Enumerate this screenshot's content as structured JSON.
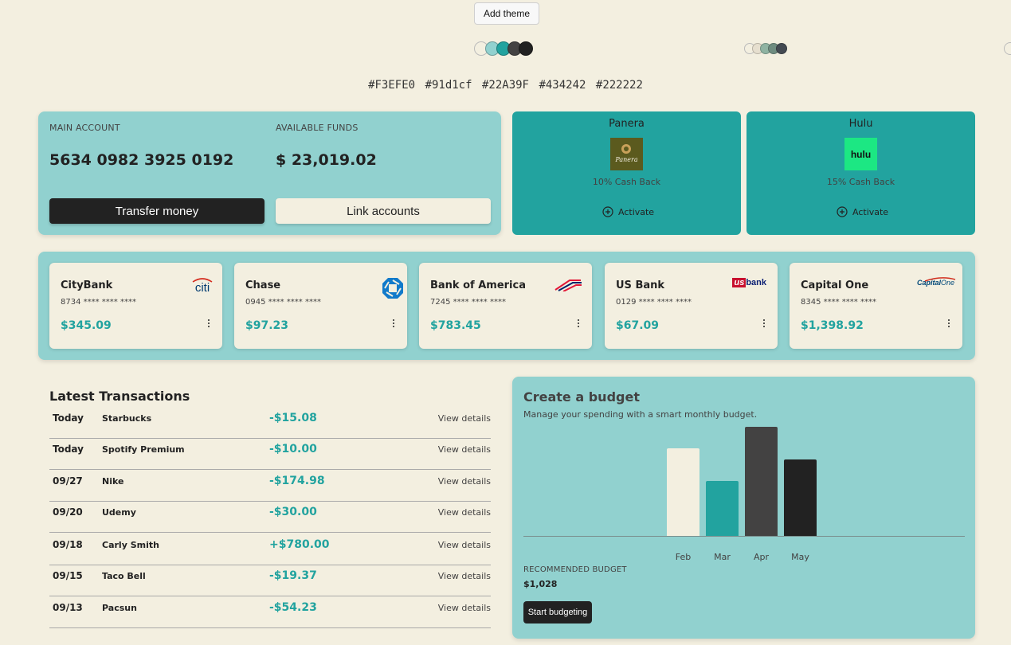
{
  "toolbar": {
    "add_theme_label": "Add theme"
  },
  "palette": {
    "colors": [
      "#F3EFE0",
      "#91d1cf",
      "#22A39F",
      "#434242",
      "#222222"
    ],
    "labels": [
      "#F3EFE0",
      "#91d1cf",
      "#22A39F",
      "#434242",
      "#222222"
    ],
    "alt_palette_colors": [
      "#F3EFE0",
      "#e6dfcf",
      "#8fb3a2",
      "#6e8c80",
      "#434a52"
    ]
  },
  "account": {
    "main_label": "MAIN ACCOUNT",
    "main_number": "5634 0982 3925 0192",
    "funds_label": "AVAILABLE FUNDS",
    "funds_value": "$ 23,019.02",
    "transfer_label": "Transfer money",
    "link_label": "Link accounts"
  },
  "offers": [
    {
      "name": "Panera",
      "logo_text": "Panera",
      "cashback": "10% Cash Back",
      "action": "Activate"
    },
    {
      "name": "Hulu",
      "logo_text": "hulu",
      "cashback": "15% Cash Back",
      "action": "Activate"
    }
  ],
  "banks": [
    {
      "name": "CityBank",
      "number": "8734 **** **** ****",
      "balance": "$345.09",
      "logo": "citi"
    },
    {
      "name": "Chase",
      "number": "0945 **** **** ****",
      "balance": "$97.23",
      "logo": "chase"
    },
    {
      "name": "Bank of America",
      "number": "7245 **** **** ****",
      "balance": "$783.45",
      "logo": "boa"
    },
    {
      "name": "US Bank",
      "number": "0129 **** **** ****",
      "balance": "$67.09",
      "logo_a": "us",
      "logo_b": "bank"
    },
    {
      "name": "Capital One",
      "number": "8345 **** **** ****",
      "balance": "$1,398.92",
      "logo_a": "Capital",
      "logo_b": "One"
    }
  ],
  "transactions": {
    "title": "Latest Transactions",
    "link_label": "View details",
    "rows": [
      {
        "date": "Today",
        "name": "Starbucks",
        "amount": "-$15.08"
      },
      {
        "date": "Today",
        "name": "Spotify Premium",
        "amount": "-$10.00"
      },
      {
        "date": "09/27",
        "name": "Nike",
        "amount": "-$174.98"
      },
      {
        "date": "09/20",
        "name": "Udemy",
        "amount": "-$30.00"
      },
      {
        "date": "09/18",
        "name": "Carly Smith",
        "amount": "+$780.00"
      },
      {
        "date": "09/15",
        "name": "Taco Bell",
        "amount": "-$19.37"
      },
      {
        "date": "09/13",
        "name": "Pacsun",
        "amount": "-$54.23"
      }
    ]
  },
  "budget": {
    "title": "Create a budget",
    "subtitle": "Manage your spending with a smart monthly budget.",
    "recommended_label": "RECOMMENDED BUDGET",
    "recommended_value": "$1,028",
    "button_label": "Start budgeting"
  },
  "chart_data": {
    "type": "bar",
    "categories": [
      "Feb",
      "Mar",
      "Apr",
      "May"
    ],
    "values": [
      80,
      50,
      100,
      70
    ],
    "colors": [
      "#F3EFE0",
      "#22A39F",
      "#434242",
      "#222222"
    ],
    "grid": false
  }
}
